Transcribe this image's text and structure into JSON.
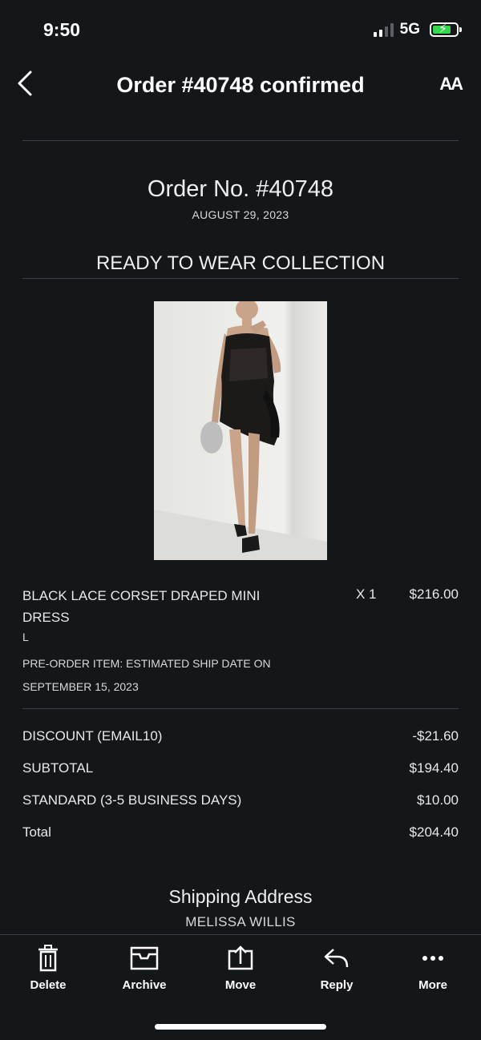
{
  "status": {
    "time": "9:50",
    "network": "5G"
  },
  "header": {
    "title": "Order #40748 confirmed",
    "font_button": "AA"
  },
  "order": {
    "number": "Order No. #40748",
    "date": "AUGUST 29, 2023",
    "collection": "READY TO WEAR COLLECTION"
  },
  "item": {
    "name": "BLACK LACE CORSET DRAPED MINI DRESS",
    "quantity": "X 1",
    "price": "$216.00",
    "size": "L",
    "note": "PRE-ORDER ITEM: ESTIMATED SHIP DATE ON SEPTEMBER 15, 2023"
  },
  "summary": [
    {
      "label": "DISCOUNT (EMAIL10)",
      "value": "-$21.60"
    },
    {
      "label": "SUBTOTAL",
      "value": "$194.40"
    },
    {
      "label": "STANDARD (3-5 BUSINESS DAYS)",
      "value": "$10.00"
    },
    {
      "label": "Total",
      "value": "$204.40"
    }
  ],
  "shipping": {
    "title": "Shipping Address",
    "name": "MELISSA WILLIS"
  },
  "toolbar": {
    "delete": "Delete",
    "archive": "Archive",
    "move": "Move",
    "reply": "Reply",
    "more": "More"
  },
  "colors": {
    "background": "#14171a",
    "battery": "#32d74b",
    "divider": "#3b3f44"
  }
}
